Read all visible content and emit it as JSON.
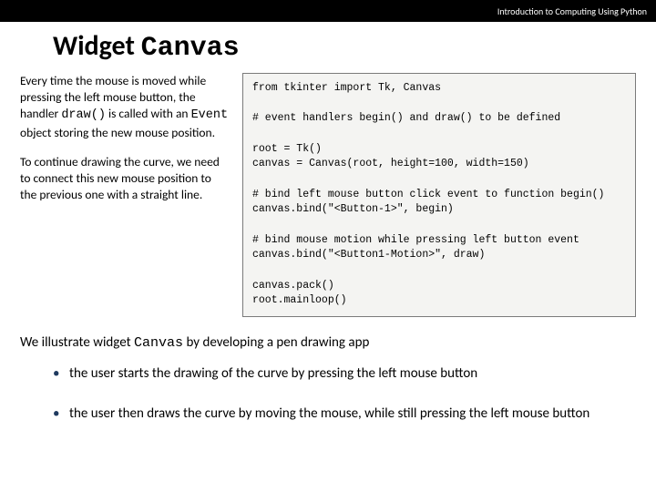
{
  "header": {
    "course": "Introduction to Computing Using Python"
  },
  "title": {
    "prefix": "Widget ",
    "mono": "Canvas"
  },
  "left": {
    "p1a": "Every time the mouse is moved while pressing the left mouse button, the handler ",
    "p1_code1": "draw()",
    "p1b": " is called with an ",
    "p1_code2": "Event",
    "p1c": " object storing the new mouse position.",
    "p2": "To continue drawing the curve, we need to connect this new mouse position to the previous one with a straight line."
  },
  "code": "from tkinter import Tk, Canvas\n\n# event handlers begin() and draw() to be defined\n\nroot = Tk()\ncanvas = Canvas(root, height=100, width=150)\n\n# bind left mouse button click event to function begin()\ncanvas.bind(\"<Button-1>\", begin)\n\n# bind mouse motion while pressing left button event\ncanvas.bind(\"<Button1-Motion>\", draw)\n\ncanvas.pack()\nroot.mainloop()",
  "below": {
    "intro_a": "We illustrate widget ",
    "intro_mono": "Canvas",
    "intro_b": " by developing a pen drawing app",
    "bullets": [
      "the user starts the drawing of the curve by pressing the left mouse button",
      "the user then draws the curve by moving the mouse, while still pressing the left mouse button"
    ]
  }
}
